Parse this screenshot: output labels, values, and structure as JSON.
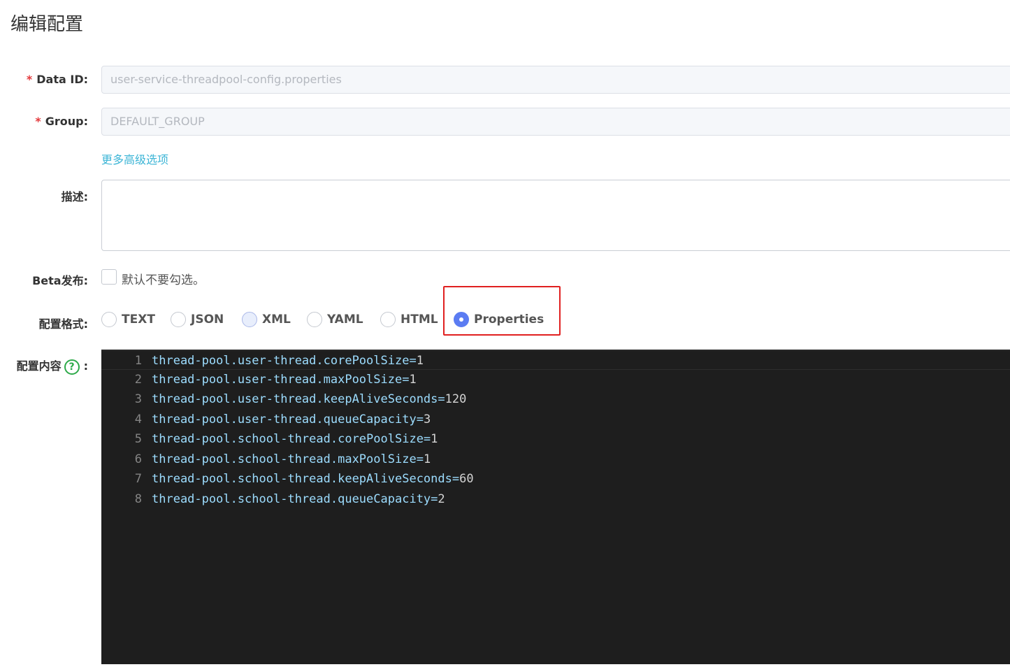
{
  "page": {
    "title": "编辑配置"
  },
  "form": {
    "data_id": {
      "required_mark": "*",
      "label": "Data ID:",
      "value": "user-service-threadpool-config.properties"
    },
    "group": {
      "required_mark": "*",
      "label": "Group:",
      "value": "DEFAULT_GROUP"
    },
    "more_options_link": "更多高级选项",
    "description": {
      "label": "描述:",
      "value": ""
    },
    "beta": {
      "label": "Beta发布:",
      "checked": false,
      "hint": "默认不要勾选。"
    },
    "format": {
      "label": "配置格式:",
      "options": [
        "TEXT",
        "JSON",
        "XML",
        "YAML",
        "HTML",
        "Properties"
      ],
      "selected": "Properties"
    },
    "content": {
      "label": "配置内容",
      "help_icon": "question-circle-icon",
      "colon": ":",
      "help_glyph": "?"
    }
  },
  "editor": {
    "lines": [
      {
        "num": "1",
        "key": "thread-pool.user-thread.corePoolSize=",
        "val": "1"
      },
      {
        "num": "2",
        "key": "thread-pool.user-thread.maxPoolSize=",
        "val": "1"
      },
      {
        "num": "3",
        "key": "thread-pool.user-thread.keepAliveSeconds=",
        "val": "120"
      },
      {
        "num": "4",
        "key": "thread-pool.user-thread.queueCapacity=",
        "val": "3"
      },
      {
        "num": "5",
        "key": "thread-pool.school-thread.corePoolSize=",
        "val": "1"
      },
      {
        "num": "6",
        "key": "thread-pool.school-thread.maxPoolSize=",
        "val": "1"
      },
      {
        "num": "7",
        "key": "thread-pool.school-thread.keepAliveSeconds=",
        "val": "60"
      },
      {
        "num": "8",
        "key": "thread-pool.school-thread.queueCapacity=",
        "val": "2"
      }
    ]
  },
  "colors": {
    "required": "#e4393c",
    "link": "#3cb5d6",
    "radio_checked": "#5b7cf2",
    "highlight": "#e02020",
    "help_icon": "#2eaa4a",
    "editor_bg": "#1e1e1e"
  }
}
